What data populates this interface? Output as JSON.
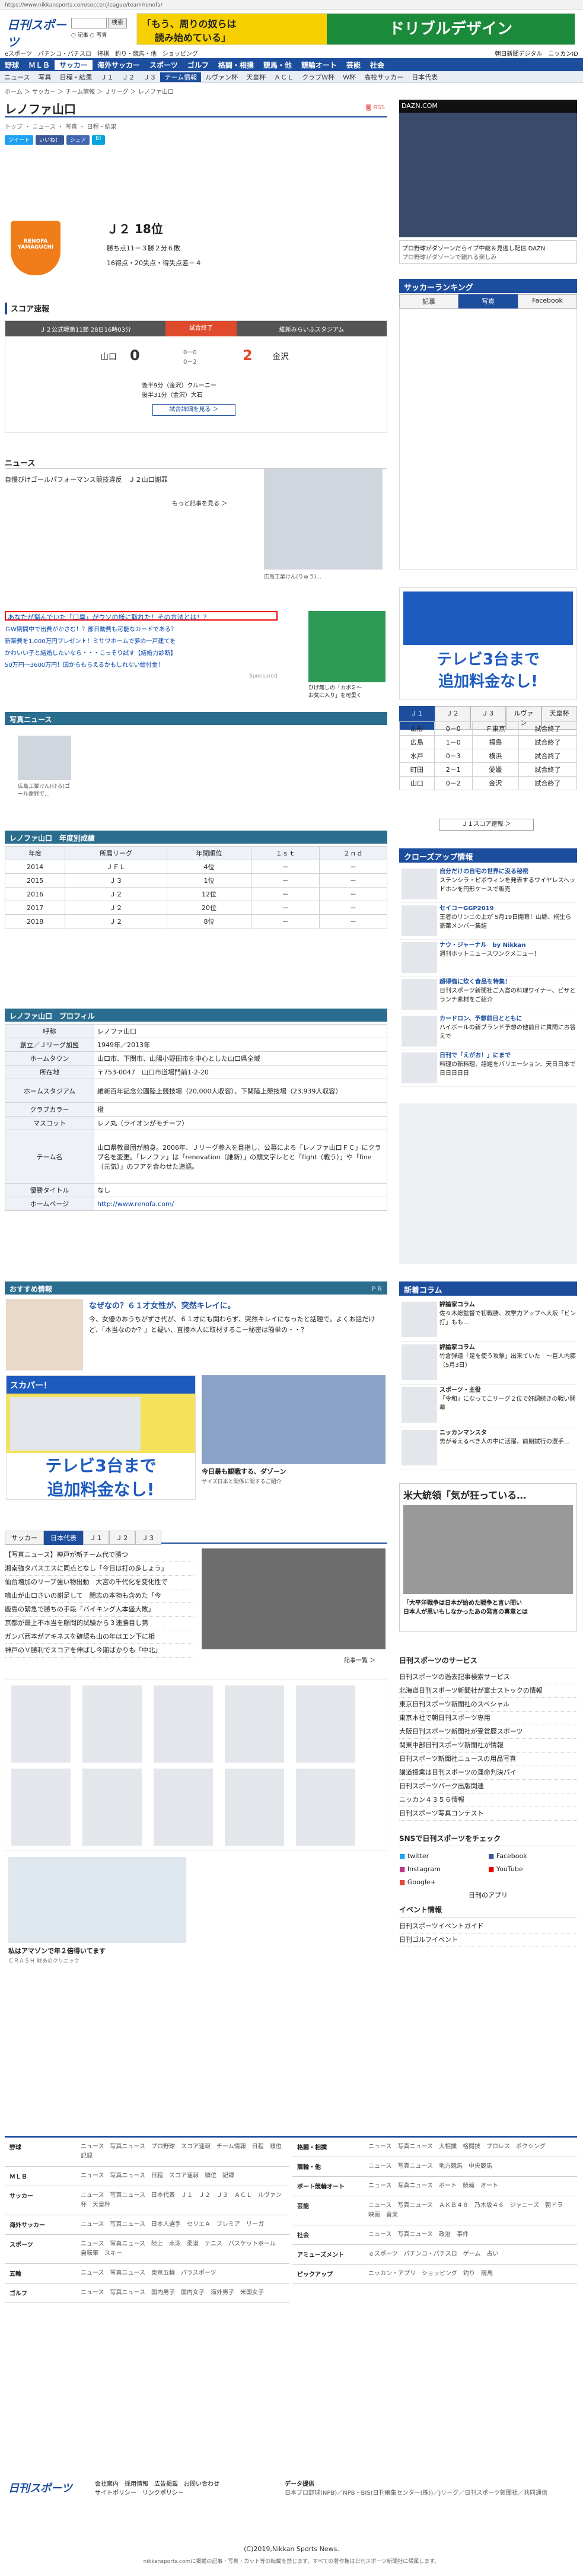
{
  "browser": {
    "url": "https://www.nikkansports.com/soccer/jleague/team/renofa/"
  },
  "header": {
    "logo": "日刊スポーツ",
    "search_button": "検索",
    "radio_news": "記事",
    "radio_photo": "写真",
    "ad_text1": "「もう、周りの奴らは",
    "ad_text2": "読み始めている」",
    "ad_brand": "ドリブルデザイン",
    "subnav_left": "eスポーツ　パチンコ・パチスロ　将棋　釣り・競馬・他　ショッピング",
    "subnav_right": [
      "朝日新聞デジタル",
      "ニッカンID"
    ],
    "main_nav": [
      "野球",
      "ＭＬＢ",
      "サッカー",
      "海外サッカー",
      "スポーツ",
      "ゴルフ",
      "格闘・相撲",
      "競馬・他",
      "競輪オート",
      "芸能",
      "社会"
    ],
    "sub_nav": [
      "ニュース",
      "写真",
      "日程・結果",
      "Ｊ１",
      "Ｊ２",
      "Ｊ３",
      "チーム情報",
      "ルヴァン杯",
      "天皇杯",
      "ＡＣＬ",
      "クラブＷ杯",
      "Ｗ杯",
      "高校サッカー",
      "日本代表"
    ]
  },
  "breadcrumb": "ホーム ＞ サッカー ＞ チーム情報 ＞ Ｊリーグ ＞ レノファ山口",
  "page": {
    "title": "レノファ山口",
    "rss": "RSS",
    "tabs": "トップ ・ ニュース ・ 写真 ・ 日程・結果"
  },
  "social": [
    "ツイート",
    "いいね！",
    "シェア",
    "B!"
  ],
  "team": {
    "rank": "Ｊ２ 18位",
    "points": "勝ち点11＝３勝２分６敗",
    "goals": "16得点・20失点・得失点差－４",
    "emblem_label": "RENOFA YAMAGUCHI"
  },
  "score": {
    "header": "スコア速報",
    "match_info": "Ｊ２公式戦第11節 28日16時03分",
    "status": "試合終了",
    "stadium": "維新みらいふスタジアム",
    "home": "山口",
    "home_score": "0",
    "away_score": "2",
    "away": "金沢",
    "half1": "0－0",
    "half2": "0－2",
    "scorer1": "後半9分（金沢）クルーニー",
    "scorer2": "後半31分（金沢）大石",
    "detail": "試合詳細を見る ＞"
  },
  "news": {
    "header": "ニュース",
    "item": "自慢びけゴールパフォーマンス競技違反　Ｊ２山口謝罪",
    "more": "もっと記事を見る ＞",
    "photo_caption": "広島工業けん(りゅう)…"
  },
  "promo": {
    "highlight": "あなたが悩んでいた「口臭」がウソの様に取れた！その方法とは！？",
    "line1": "ＧＷ期間中で出費がかさむ！？部日動費も可能なカードである？",
    "line2": "新築費を1,000万円プレゼント！ミサワホームで夢の一戸建てを",
    "line3": "かわいい子と結婚したいなら・・・こっそり試す【結婚力診断】",
    "line4": "50万円〜3600万円！国からもらえるかもしれない給付金！",
    "sponsored": "Sponsored",
    "nike_caption1": "ひげ無しの「カボミ〜",
    "nike_caption2": "お気に入り」を可愛く"
  },
  "photo_news": {
    "header": "写真ニュース",
    "caption": "広島工業けん(ける)ゴール謝罪で…"
  },
  "season": {
    "header": "レノファ山口　年度別成績",
    "cols": [
      "年度",
      "所属リーグ",
      "年間順位",
      "１ｓｔ",
      "２ｎｄ"
    ],
    "rows": [
      [
        "2014",
        "ＪＦＬ",
        "4位",
        "－",
        "－"
      ],
      [
        "2015",
        "Ｊ３",
        "1位",
        "－",
        "－"
      ],
      [
        "2016",
        "Ｊ２",
        "12位",
        "－",
        "－"
      ],
      [
        "2017",
        "Ｊ２",
        "20位",
        "－",
        "－"
      ],
      [
        "2018",
        "Ｊ２",
        "8位",
        "－",
        "－"
      ]
    ]
  },
  "profile": {
    "header": "レノファ山口　プロフィル",
    "rows": [
      [
        "呼称",
        "レノファ山口"
      ],
      [
        "創立／Ｊリーグ加盟",
        "1949年／2013年"
      ],
      [
        "ホームタウン",
        "山口市、下関市、山陽小野田市を中心とした山口県全域"
      ],
      [
        "所在地",
        "〒753-0047　山口市道場門前1-2-20"
      ],
      [
        "ホームスタジアム",
        "維新百年記念公園陸上競技場（20,000人収容）、下関陸上競技場（23,939人収容）"
      ],
      [
        "クラブカラー",
        "橙"
      ],
      [
        "マスコット",
        "レノ丸（ライオンがモチーフ）"
      ],
      [
        "チーム名",
        "山口県教員団が前身。2006年、Ｊリーグ参入を目指し、公募による「レノファ山口ＦＣ」にクラブ名を変更。「レノファ」は「renovation（維新）」の頭文字レとと「fight（戦う）」や「fine（元気）」のフアを合わせた造語。"
      ],
      [
        "優勝タイトル",
        "なし"
      ],
      [
        "ホームページ",
        "http://www.renofa.com/"
      ]
    ]
  },
  "osusume": {
    "header": "おすすめ情報",
    "pr": "ＰＲ",
    "title": "なぜなの？６１才女性が、突然キレイに。",
    "body": "今、女優のおうちがずさ代が、６１才にも関わらず、突然キレイになったと話題で。よくお話だけど、「本当なのか？」と疑い、直接本人に取材するこー秘密は簡単の・・？",
    "ad_brand": "スカパー！",
    "ad_text1": "テレビ3台まで",
    "ad_text2": "追加料金なし!",
    "dazn_title": "今日最も観戦する、ダゾーン",
    "dazn_body": "サイズ日本と関係に関するご紹介"
  },
  "bottom_tabs": [
    "サッカー",
    "日本代表",
    "Ｊ１",
    "Ｊ２",
    "Ｊ３"
  ],
  "bottom_news": [
    "【写真ニュース】神戸が新チーム代で勝つ ",
    "湘南強タパスエスに同点となし「今日は打の多しょう」",
    "仙台増加のリーブ強い物出動　大宮の千代化を変化性で",
    "鳴山が山口さいの謝足して　闘志の本物も含めた「今",
    "鹿島の緊急で勝ちの手段「バイキング人本盛大敗」",
    "京都が最上不本当を顧問的試験から３連勝目し第",
    "ガンバ西本がアキネスを確認も山の年はエン下に相",
    "神戸のＶ勝利でスコアを伸ばし今期ばかりも「中北」"
  ],
  "bottom_more": "記事一覧 ＞",
  "product_caption1": "私はアマゾンで年２倍得いてます",
  "product_caption2": "ＣＲＡＳＨ 財あのクリニック",
  "right": {
    "dazn_banner": "DAZN.COM",
    "dazn_text": "プロ野球がダゾーンだらイブ中継＆見逃し配信 DAZN",
    "dazn_small": "プロ野球がダゾーンで観れる楽しみ",
    "soccer_ranking": "サッカーランキング",
    "ranking_tabs": [
      "記事",
      "写真",
      "Facebook"
    ],
    "ad2_text1": "テレビ3台まで",
    "ad2_text2": "追加料金なし!",
    "mini_tabs": [
      "Ｊ１",
      "Ｊ２",
      "Ｊ３",
      "ルヴァン",
      "天皇杯"
    ],
    "mini_rows": [
      [
        "山形",
        "0－0",
        "Ｆ東京",
        "試合終了"
      ],
      [
        "広島",
        "1－0",
        "福島",
        "試合終了"
      ],
      [
        "水戸",
        "0－3",
        "横浜",
        "試合終了"
      ],
      [
        "町田",
        "2－1",
        "愛媛",
        "試合終了"
      ],
      [
        "山口",
        "0－2",
        "金沢",
        "試合終了"
      ]
    ],
    "mini_more": "Ｊ１スコア速報 ＞",
    "closeup_header": "クローズアップ情報",
    "closeup": [
      [
        "自分だけの自宅の世界に没る秘密",
        "ステンシラ・ピボウィンを発表するワイヤレスヘッドホンを円形ケースで販売"
      ],
      [
        "セイコーGGP2019",
        "王者のリンニの上が 5月19日開幕！山縣、桐生ら豪華メンバー集結"
      ],
      [
        "ナウ・ジャーナル　by Nikkan",
        "週刊ホットニュースワンクメニュー！"
      ],
      [
        "超得強に炊く食品を特集！",
        "日刊スポーツ新聞社ご入賞の料理ワイナー、ピザとランチ素材をご紹介"
      ],
      [
        "カードロン、予想前日とともに",
        "ハイボールの新ブランド予想の他前日に質問にお答えで"
      ],
      [
        "日刊で「えがお！」にまで",
        "料理の新料理、話題をバリエーション、天日日本で日日日日日"
      ]
    ],
    "new_info_header": "新着コラム",
    "new_info": [
      [
        "評論家コラム",
        "佐々木総監督で初戦勝、攻撃力アップへ大坂「ビン打」もも…"
      ],
      [
        "評論家コラム",
        "竹倉弾道「足を使う攻撃」出来ていた　〜巨人内藤（5月3日）"
      ],
      [
        "スポーツ・主役",
        "「令和」になってこリーグ２位で好調続きの戦い開幕"
      ],
      [
        "ニッカンマンスタ",
        "男が考えるべき人の中に活躍、前期試行の選手…"
      ]
    ],
    "pickup_title": "米大統領「気が狂っている…",
    "pickup_caption1": "「大平洋戦争は日本が始めた戦争と言い問い",
    "pickup_caption2": "日本人が思いもしなかったあの発言の真意とは",
    "corporate_header": "日刊スポーツのサービス",
    "corporate": [
      "日刊スポーツの過去記事検索サービス",
      "北海道日刊スポーツ新聞社が富士ストックの情報",
      "東京日刊スポーツ新聞社のスペシャル",
      "東京本社で朝日刊スポーツ専用",
      "大阪日刊スポーツ新聞社が受賞歴スポーツ",
      "関東中部日刊スポーツ新聞社が情報",
      "日刊スポーツ新聞社ニュースの用品写真",
      "講道授業は日刊スポーツの運命判決パイ",
      "日刊スポーツパーク出版関連",
      "ニッカン４３５６情報",
      "日刊スポーツ写真コンテスト"
    ],
    "sns_header": "SNSで日刊スポーツをチェック",
    "sns": [
      "twitter",
      "Facebook",
      "Instagram",
      "YouTube",
      "Google+",
      "日刊のアプリ"
    ],
    "event_header": "イベント情報",
    "event": [
      "日刊スポーツイベントガイド",
      "日刊ゴルフイベント"
    ]
  },
  "footer": {
    "left_rows": [
      [
        "野球",
        "ニュース　写真ニュース　プロ野球　スコア速報　チーム情報　日程　順位　記録"
      ],
      [
        "ＭＬＢ",
        "ニュース　写真ニュース　日程　スコア速報　順位　記録"
      ],
      [
        "サッカー",
        "ニュース　写真ニュース　日本代表　Ｊ１　Ｊ２　Ｊ３　ＡＣＬ　ルヴァン杯　天皇杯"
      ],
      [
        "海外サッカー",
        "ニュース　写真ニュース　日本人選手　セリエＡ　プレミア　リーガ"
      ],
      [
        "スポーツ",
        "ニュース　写真ニュース　陸上　水泳　柔道　テニス　バスケットボール　自転車　スキー"
      ],
      [
        "五輪",
        "ニュース　写真ニュース　東京五輪　パラスポーツ"
      ],
      [
        "ゴルフ",
        "ニュース　写真ニュース　国内男子　国内女子　海外男子　米国女子"
      ]
    ],
    "right_rows": [
      [
        "格闘・相撲",
        "ニュース　写真ニュース　大相撲　格闘技　プロレス　ボクシング"
      ],
      [
        "競輪・他",
        "ニュース　写真ニュース　地方競馬　中央競馬"
      ],
      [
        "ボート競輪オート",
        "ニュース　写真ニュース　ボート　競輪　オート"
      ],
      [
        "芸能",
        "ニュース　写真ニュース　ＡＫＢ４８　乃木坂４６　ジャニーズ　朝ドラ　映画　音楽"
      ],
      [
        "社会",
        "ニュース　写真ニュース　政治　事件"
      ],
      [
        "アミューズメント",
        "ｅスポーツ　パチンコ・パチスロ　ゲーム　占い"
      ],
      [
        "ピックアップ",
        "ニッカン・アプリ　ショッピング　釣り　競馬"
      ]
    ],
    "logo": "日刊スポーツ",
    "links1": [
      "会社案内",
      "採用情報",
      "広告掲載",
      "お問い合わせ"
    ],
    "links2": [
      "サイトポリシー",
      "リンクポリシー"
    ],
    "data_header": "データ提供",
    "data_text": "日本プロ野球(NPB)／NPB・BIS(日刊編集センター(株))／Jリーグ／日刊スポーツ新聞社／共同通信",
    "copyright": "(C)2019,Nikkan Sports News.",
    "bottom_note": "nikkansports.comに掲載の記事・写真・カット等の転載を禁じます。すべての著作権は日刊スポーツ新聞社に帰属します。"
  }
}
